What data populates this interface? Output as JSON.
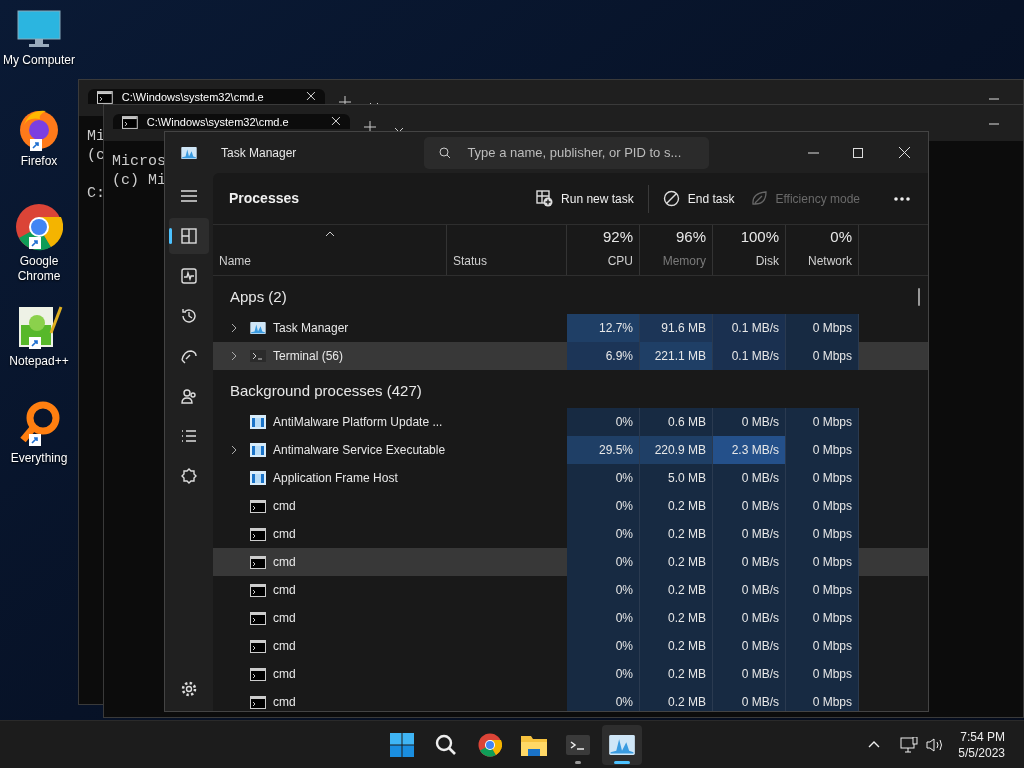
{
  "desktop_icons": [
    {
      "label": "My Computer",
      "kind": "computer",
      "shortcut": false
    },
    {
      "label": "Firefox",
      "kind": "firefox",
      "shortcut": true
    },
    {
      "label": "Google Chrome",
      "kind": "chrome",
      "shortcut": true
    },
    {
      "label": "Notepad++",
      "kind": "notepad",
      "shortcut": true
    },
    {
      "label": "Everything",
      "kind": "everything",
      "shortcut": true
    }
  ],
  "cmd_windows": [
    {
      "tab_title": "C:\\Windows\\system32\\cmd.e",
      "lines": [
        "Mi",
        "(c"
      ],
      "prompt": "C:"
    },
    {
      "tab_title": "C:\\Windows\\system32\\cmd.e",
      "lines": [
        "Micros",
        "(c) Mi"
      ]
    }
  ],
  "task_manager": {
    "title": "Task Manager",
    "search": {
      "placeholder": "Type a name, publisher, or PID to s..."
    },
    "nav": [
      {
        "kind": "menu",
        "selected": false
      },
      {
        "kind": "processes",
        "selected": true
      },
      {
        "kind": "performance",
        "selected": false
      },
      {
        "kind": "history",
        "selected": false
      },
      {
        "kind": "startup",
        "selected": false
      },
      {
        "kind": "users",
        "selected": false
      },
      {
        "kind": "details",
        "selected": false
      },
      {
        "kind": "services",
        "selected": false
      },
      {
        "kind": "settings",
        "selected": false
      }
    ],
    "page_title": "Processes",
    "toolbar": [
      {
        "label": "Run new task",
        "kind": "run",
        "disabled": false
      },
      {
        "label": "End task",
        "kind": "end",
        "disabled": false
      },
      {
        "label": "Efficiency mode",
        "kind": "leaf",
        "disabled": true
      }
    ],
    "columns": [
      {
        "label": "Name",
        "sorted": true,
        "dimmed": false
      },
      {
        "label": "Status",
        "sorted": false,
        "dimmed": false
      },
      {
        "label": "CPU",
        "usage": "92%",
        "sorted": false,
        "dimmed": false
      },
      {
        "label": "Memory",
        "usage": "96%",
        "sorted": false,
        "dimmed": true
      },
      {
        "label": "Disk",
        "usage": "100%",
        "sorted": false,
        "dimmed": false
      },
      {
        "label": "Network",
        "usage": "0%",
        "sorted": false,
        "dimmed": false
      }
    ],
    "groups": [
      {
        "title": "Apps (2)",
        "rows": [
          {
            "name": "Task Manager",
            "kind": "taskmgr",
            "expandable": true,
            "highlighted": false,
            "cells": [
              {
                "text": "12.7%",
                "color": "#1f3f66"
              },
              {
                "text": "91.6 MB",
                "color": "#1c3557"
              },
              {
                "text": "0.1 MB/s",
                "color": "#1a3050"
              },
              {
                "text": "0 Mbps",
                "color": "#172a42"
              }
            ]
          },
          {
            "name": "Terminal (56)",
            "kind": "terminal",
            "expandable": true,
            "highlighted": true,
            "cells": [
              {
                "text": "6.9%",
                "color": "#1c3557"
              },
              {
                "text": "221.1 MB",
                "color": "#1f3f66"
              },
              {
                "text": "0.1 MB/s",
                "color": "#1a3050"
              },
              {
                "text": "0 Mbps",
                "color": "#172a42"
              }
            ]
          }
        ]
      },
      {
        "title": "Background processes (427)",
        "rows": [
          {
            "name": "AntiMalware Platform Update ...",
            "kind": "service",
            "expandable": false,
            "highlighted": false,
            "cells": [
              {
                "text": "0%",
                "color": "#172a42"
              },
              {
                "text": "0.6 MB",
                "color": "#172a42"
              },
              {
                "text": "0 MB/s",
                "color": "#172a42"
              },
              {
                "text": "0 Mbps",
                "color": "#172a42"
              }
            ]
          },
          {
            "name": "Antimalware Service Executable",
            "kind": "service",
            "expandable": true,
            "highlighted": false,
            "cells": [
              {
                "text": "29.5%",
                "color": "#1f3f66"
              },
              {
                "text": "220.9 MB",
                "color": "#1f3f66"
              },
              {
                "text": "2.3 MB/s",
                "color": "#24508a"
              },
              {
                "text": "0 Mbps",
                "color": "#172a42"
              }
            ]
          },
          {
            "name": "Application Frame Host",
            "kind": "service",
            "expandable": false,
            "highlighted": false,
            "cells": [
              {
                "text": "0%",
                "color": "#172a42"
              },
              {
                "text": "5.0 MB",
                "color": "#172a42"
              },
              {
                "text": "0 MB/s",
                "color": "#172a42"
              },
              {
                "text": "0 Mbps",
                "color": "#172a42"
              }
            ]
          },
          {
            "name": "cmd",
            "kind": "cmd",
            "expandable": false,
            "highlighted": false,
            "cells": [
              {
                "text": "0%",
                "color": "#172a42"
              },
              {
                "text": "0.2 MB",
                "color": "#172a42"
              },
              {
                "text": "0 MB/s",
                "color": "#172a42"
              },
              {
                "text": "0 Mbps",
                "color": "#172a42"
              }
            ]
          },
          {
            "name": "cmd",
            "kind": "cmd",
            "expandable": false,
            "highlighted": false,
            "cells": [
              {
                "text": "0%",
                "color": "#172a42"
              },
              {
                "text": "0.2 MB",
                "color": "#172a42"
              },
              {
                "text": "0 MB/s",
                "color": "#172a42"
              },
              {
                "text": "0 Mbps",
                "color": "#172a42"
              }
            ]
          },
          {
            "name": "cmd",
            "kind": "cmd",
            "expandable": false,
            "highlighted": true,
            "cells": [
              {
                "text": "0%",
                "color": "#172a42"
              },
              {
                "text": "0.2 MB",
                "color": "#172a42"
              },
              {
                "text": "0 MB/s",
                "color": "#172a42"
              },
              {
                "text": "0 Mbps",
                "color": "#172a42"
              }
            ]
          },
          {
            "name": "cmd",
            "kind": "cmd",
            "expandable": false,
            "highlighted": false,
            "cells": [
              {
                "text": "0%",
                "color": "#172a42"
              },
              {
                "text": "0.2 MB",
                "color": "#172a42"
              },
              {
                "text": "0 MB/s",
                "color": "#172a42"
              },
              {
                "text": "0 Mbps",
                "color": "#172a42"
              }
            ]
          },
          {
            "name": "cmd",
            "kind": "cmd",
            "expandable": false,
            "highlighted": false,
            "cells": [
              {
                "text": "0%",
                "color": "#172a42"
              },
              {
                "text": "0.2 MB",
                "color": "#172a42"
              },
              {
                "text": "0 MB/s",
                "color": "#172a42"
              },
              {
                "text": "0 Mbps",
                "color": "#172a42"
              }
            ]
          },
          {
            "name": "cmd",
            "kind": "cmd",
            "expandable": false,
            "highlighted": false,
            "cells": [
              {
                "text": "0%",
                "color": "#172a42"
              },
              {
                "text": "0.2 MB",
                "color": "#172a42"
              },
              {
                "text": "0 MB/s",
                "color": "#172a42"
              },
              {
                "text": "0 Mbps",
                "color": "#172a42"
              }
            ]
          },
          {
            "name": "cmd",
            "kind": "cmd",
            "expandable": false,
            "highlighted": false,
            "cells": [
              {
                "text": "0%",
                "color": "#172a42"
              },
              {
                "text": "0.2 MB",
                "color": "#172a42"
              },
              {
                "text": "0 MB/s",
                "color": "#172a42"
              },
              {
                "text": "0 Mbps",
                "color": "#172a42"
              }
            ]
          },
          {
            "name": "cmd",
            "kind": "cmd",
            "expandable": false,
            "highlighted": false,
            "cells": [
              {
                "text": "0%",
                "color": "#172a42"
              },
              {
                "text": "0.2 MB",
                "color": "#172a42"
              },
              {
                "text": "0 MB/s",
                "color": "#172a42"
              },
              {
                "text": "0 Mbps",
                "color": "#172a42"
              }
            ]
          }
        ]
      }
    ]
  },
  "taskbar": {
    "apps": [
      {
        "kind": "start",
        "running": false,
        "active": false
      },
      {
        "kind": "search",
        "running": false,
        "active": false
      },
      {
        "kind": "chrome",
        "running": false,
        "active": false
      },
      {
        "kind": "folder",
        "running": false,
        "active": false
      },
      {
        "kind": "terminal",
        "running": true,
        "active": false
      },
      {
        "kind": "taskmgr",
        "running": true,
        "active": true
      }
    ],
    "time": "7:54 PM",
    "date": "5/5/2023"
  }
}
